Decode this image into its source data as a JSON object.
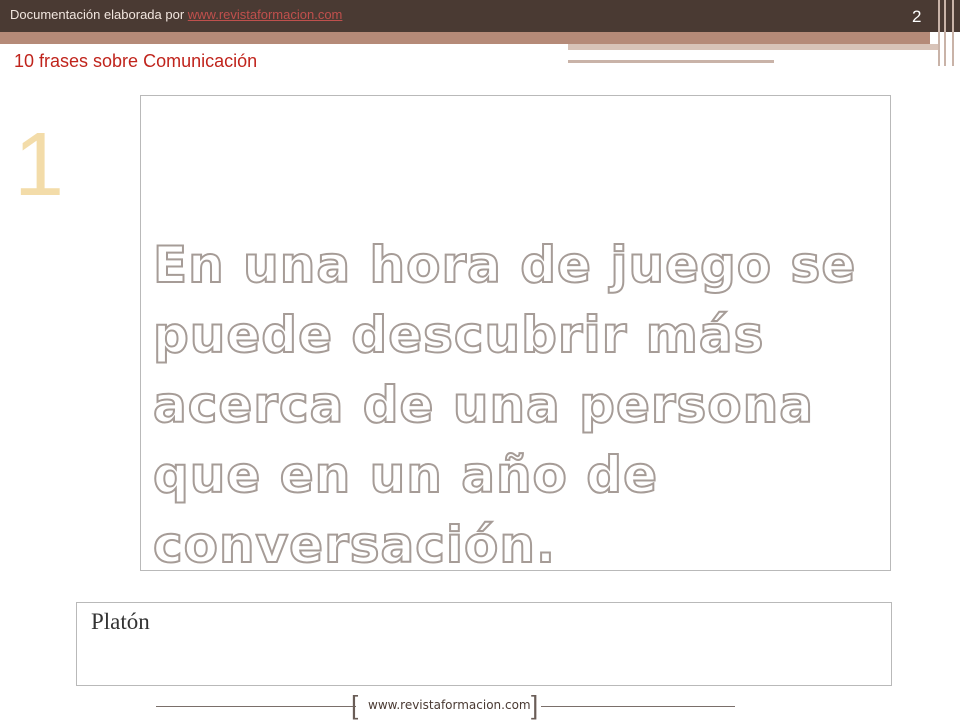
{
  "header": {
    "prefix": "Documentación elaborada por ",
    "link": "www.revistaformacion.com",
    "page_number": "2"
  },
  "slide": {
    "subtitle": "10 frases sobre Comunicación",
    "number": "1",
    "quote": "En una hora de juego se puede descubrir más acerca de una persona que en un año de conversación.",
    "author": "Platón"
  },
  "footer": {
    "url": "www.revistaformacion.com"
  },
  "colors": {
    "header_bg": "#4a3a33",
    "link": "#c0504d",
    "subtitle": "#c0241c",
    "number": "#f3dca9"
  }
}
